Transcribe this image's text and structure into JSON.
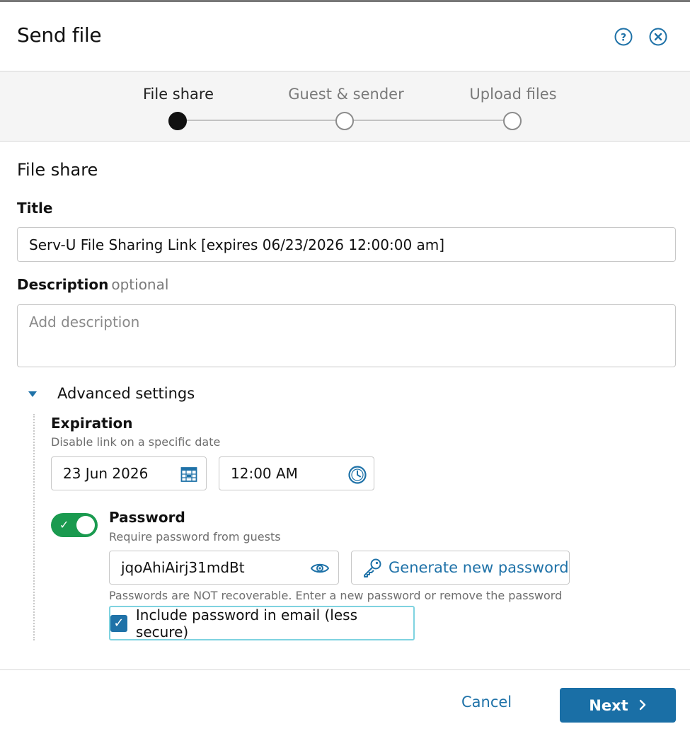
{
  "dialog": {
    "title": "Send file"
  },
  "stepper": {
    "steps": [
      {
        "label": "File share",
        "active": true
      },
      {
        "label": "Guest & sender",
        "active": false
      },
      {
        "label": "Upload files",
        "active": false
      }
    ]
  },
  "form": {
    "section_title": "File share",
    "title_label": "Title",
    "title_value": "Serv-U File Sharing Link [expires 06/23/2026 12:00:00 am]",
    "description_label": "Description",
    "description_optional": "optional",
    "description_placeholder": "Add description"
  },
  "advanced": {
    "label": "Advanced settings",
    "expiration_label": "Expiration",
    "expiration_hint": "Disable link on a specific date",
    "date_value": "23 Jun 2026",
    "time_value": "12:00 AM",
    "password_label": "Password",
    "password_hint": "Require password from guests",
    "password_enabled": true,
    "password_value": "jqoAhiAirj31mdBt",
    "generate_label": "Generate new password",
    "password_warning": "Passwords are NOT recoverable. Enter a new password or remove the password",
    "include_label": "Include password in email (less secure)",
    "include_checked": true
  },
  "footer": {
    "cancel_label": "Cancel",
    "next_label": "Next"
  },
  "colors": {
    "accent": "#1f72a8",
    "primary_button": "#1a6fa6",
    "toggle_on": "#1a9a4f",
    "focus_ring": "#7fd3e0"
  },
  "icons": {
    "help": "help-circle-icon",
    "close": "close-circle-icon",
    "calendar": "calendar-icon",
    "clock": "clock-icon",
    "eye": "eye-icon",
    "key": "key-icon",
    "chevron": "chevron-right-icon"
  }
}
